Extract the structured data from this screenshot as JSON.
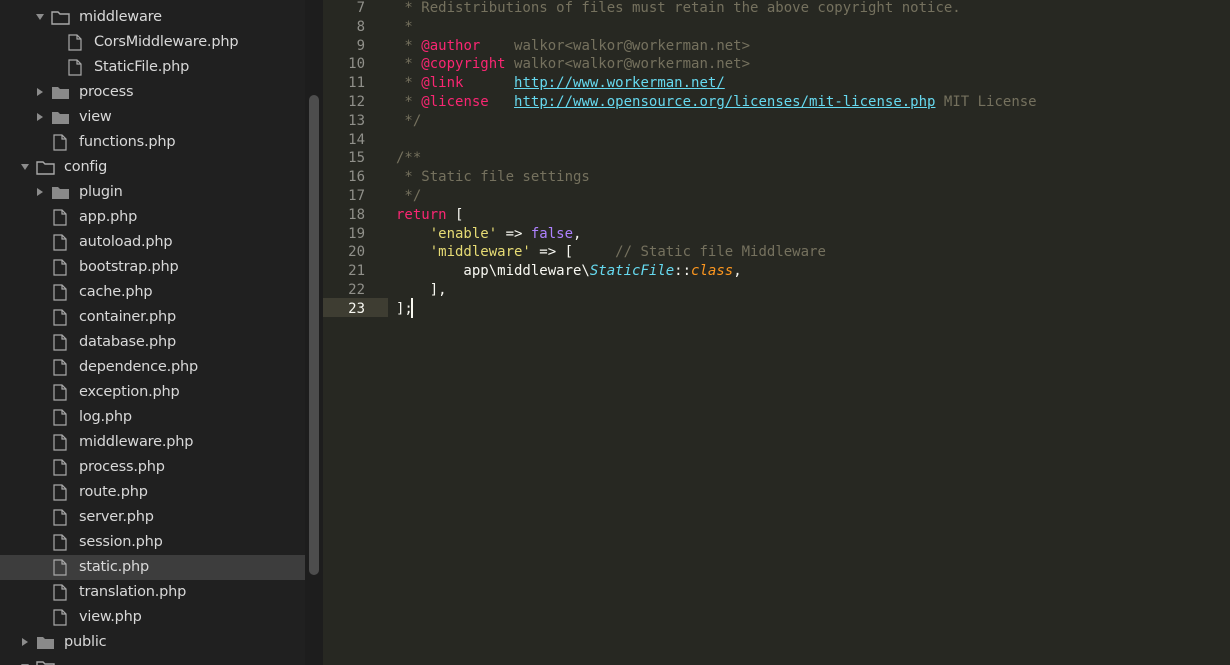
{
  "sidebar": {
    "items": [
      {
        "label": "middleware",
        "type": "folder",
        "open": true,
        "depth": 1
      },
      {
        "label": "CorsMiddleware.php",
        "type": "file",
        "depth": 2
      },
      {
        "label": "StaticFile.php",
        "type": "file",
        "depth": 2
      },
      {
        "label": "process",
        "type": "folder",
        "open": false,
        "depth": 1
      },
      {
        "label": "view",
        "type": "folder",
        "open": false,
        "depth": 1
      },
      {
        "label": "functions.php",
        "type": "file",
        "depth": 1
      },
      {
        "label": "config",
        "type": "folder",
        "open": true,
        "depth": 0
      },
      {
        "label": "plugin",
        "type": "folder",
        "open": false,
        "depth": 1
      },
      {
        "label": "app.php",
        "type": "file",
        "depth": 1
      },
      {
        "label": "autoload.php",
        "type": "file",
        "depth": 1
      },
      {
        "label": "bootstrap.php",
        "type": "file",
        "depth": 1
      },
      {
        "label": "cache.php",
        "type": "file",
        "depth": 1
      },
      {
        "label": "container.php",
        "type": "file",
        "depth": 1
      },
      {
        "label": "database.php",
        "type": "file",
        "depth": 1
      },
      {
        "label": "dependence.php",
        "type": "file",
        "depth": 1
      },
      {
        "label": "exception.php",
        "type": "file",
        "depth": 1
      },
      {
        "label": "log.php",
        "type": "file",
        "depth": 1
      },
      {
        "label": "middleware.php",
        "type": "file",
        "depth": 1
      },
      {
        "label": "process.php",
        "type": "file",
        "depth": 1
      },
      {
        "label": "route.php",
        "type": "file",
        "depth": 1
      },
      {
        "label": "server.php",
        "type": "file",
        "depth": 1
      },
      {
        "label": "session.php",
        "type": "file",
        "depth": 1
      },
      {
        "label": "static.php",
        "type": "file",
        "depth": 1,
        "selected": true
      },
      {
        "label": "translation.php",
        "type": "file",
        "depth": 1
      },
      {
        "label": "view.php",
        "type": "file",
        "depth": 1
      },
      {
        "label": "public",
        "type": "folder",
        "open": false,
        "depth": 0
      },
      {
        "label": "",
        "type": "folder",
        "open": true,
        "depth": 0
      }
    ]
  },
  "editor": {
    "line_numbers": [
      "7",
      "8",
      "9",
      "10",
      "11",
      "12",
      "13",
      "14",
      "15",
      "16",
      "17",
      "18",
      "19",
      "20",
      "21",
      "22",
      "23"
    ],
    "current_line": "23",
    "lines": [
      [
        {
          "t": " * Redistributions of files must retain the above copyright notice.",
          "c": "comment"
        }
      ],
      [
        {
          "t": " *",
          "c": "comment"
        }
      ],
      [
        {
          "t": " * ",
          "c": "comment"
        },
        {
          "t": "@author",
          "c": "tag"
        },
        {
          "t": "    walkor<walkor@workerman.net>",
          "c": "comment"
        }
      ],
      [
        {
          "t": " * ",
          "c": "comment"
        },
        {
          "t": "@copyright",
          "c": "tag"
        },
        {
          "t": " walkor<walkor@workerman.net>",
          "c": "comment"
        }
      ],
      [
        {
          "t": " * ",
          "c": "comment"
        },
        {
          "t": "@link",
          "c": "tag"
        },
        {
          "t": "      ",
          "c": "comment"
        },
        {
          "t": "http://www.workerman.net/",
          "c": "link"
        }
      ],
      [
        {
          "t": " * ",
          "c": "comment"
        },
        {
          "t": "@license",
          "c": "tag"
        },
        {
          "t": "   ",
          "c": "comment"
        },
        {
          "t": "http://www.opensource.org/licenses/mit-license.php",
          "c": "link"
        },
        {
          "t": " MIT License",
          "c": "comment"
        }
      ],
      [
        {
          "t": " */",
          "c": "comment"
        }
      ],
      [
        {
          "t": "",
          "c": "op"
        }
      ],
      [
        {
          "t": "/**",
          "c": "comment"
        }
      ],
      [
        {
          "t": " * Static file settings",
          "c": "comment"
        }
      ],
      [
        {
          "t": " */",
          "c": "comment"
        }
      ],
      [
        {
          "t": "return",
          "c": "keyword"
        },
        {
          "t": " [",
          "c": "op"
        }
      ],
      [
        {
          "t": "    ",
          "c": "op"
        },
        {
          "t": "'enable'",
          "c": "string"
        },
        {
          "t": " => ",
          "c": "op"
        },
        {
          "t": "false",
          "c": "const"
        },
        {
          "t": ",",
          "c": "op"
        }
      ],
      [
        {
          "t": "    ",
          "c": "op"
        },
        {
          "t": "'middleware'",
          "c": "string"
        },
        {
          "t": " => [     ",
          "c": "op"
        },
        {
          "t": "// Static file Middleware",
          "c": "comment"
        }
      ],
      [
        {
          "t": "        app\\middleware\\",
          "c": "op"
        },
        {
          "t": "StaticFile",
          "c": "class"
        },
        {
          "t": "::",
          "c": "op"
        },
        {
          "t": "class",
          "c": "classkw"
        },
        {
          "t": ",",
          "c": "op"
        }
      ],
      [
        {
          "t": "    ],",
          "c": "op"
        }
      ],
      [
        {
          "t": "];",
          "c": "op"
        }
      ]
    ]
  },
  "colors": {
    "sidebar_bg": "#202020",
    "editor_bg": "#272822",
    "selection_bg": "#3d3d3d",
    "folder_icon": "#8a8a8a"
  }
}
